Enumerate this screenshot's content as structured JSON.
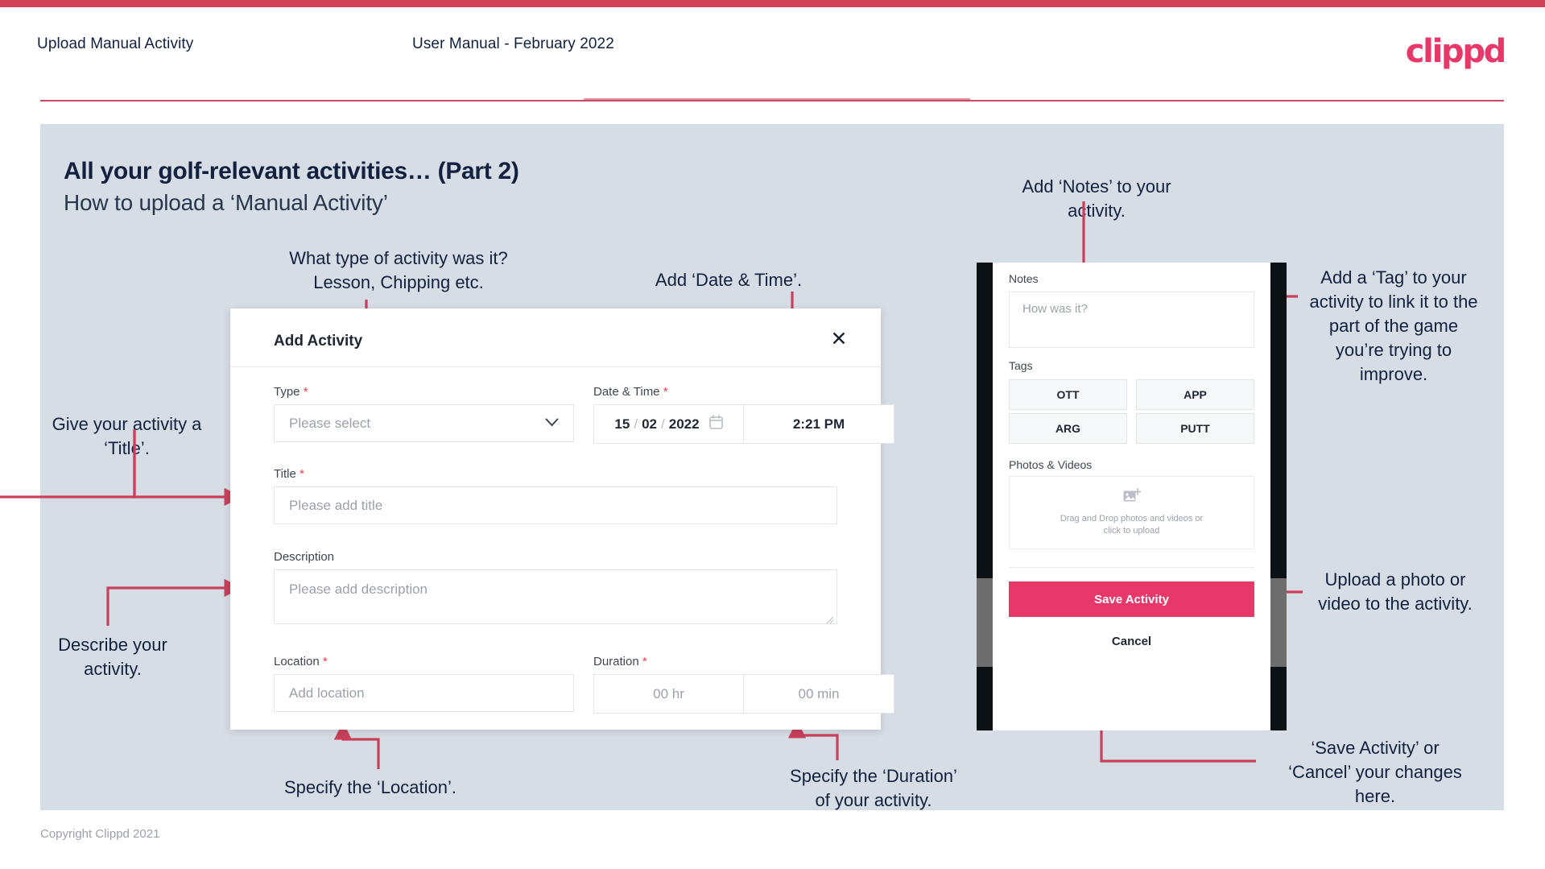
{
  "header": {
    "left_title": "Upload Manual Activity",
    "center_title": "User Manual - February 2022",
    "logo": "clippd"
  },
  "slide": {
    "heading": "All your golf-relevant activities… (Part 2)",
    "subheading": "How to upload a ‘Manual Activity’"
  },
  "annotations": {
    "type": "What type of activity was it?\nLesson, Chipping etc.",
    "type_l1": "What type of activity was it?",
    "type_l2": "Lesson, Chipping etc.",
    "datetime": "Add ‘Date & Time’.",
    "notes_l1": "Add ‘Notes’ to your",
    "notes_l2": "activity.",
    "tag": "Add a ‘Tag’ to your activity to link it to the part of the game you’re trying to improve.",
    "title_l1": "Give your activity a",
    "title_l2": "‘Title’.",
    "describe_l1": "Describe your",
    "describe_l2": "activity.",
    "location": "Specify the ‘Location’.",
    "duration_l1": "Specify the ‘Duration’",
    "duration_l2": "of your activity.",
    "upload_l1": "Upload a photo or",
    "upload_l2": "video to the activity.",
    "save_l1": "‘Save Activity’ or",
    "save_l2": "‘Cancel’ your changes",
    "save_l3": "here."
  },
  "dialog": {
    "title": "Add Activity",
    "close_icon": "close-icon",
    "fields": {
      "type": {
        "label": "Type",
        "required": "*",
        "placeholder": "Please select"
      },
      "datetime": {
        "label": "Date & Time",
        "required": "*",
        "day": "15",
        "month": "02",
        "year": "2022",
        "sep": "/",
        "time": "2:21 PM"
      },
      "title": {
        "label": "Title",
        "required": "*",
        "placeholder": "Please add title"
      },
      "description": {
        "label": "Description",
        "required": "",
        "placeholder": "Please add description"
      },
      "location": {
        "label": "Location",
        "required": "*",
        "placeholder": "Add location"
      },
      "duration": {
        "label": "Duration",
        "required": "*",
        "hours": "00 hr",
        "minutes": "00 min"
      }
    }
  },
  "phone": {
    "notes_label": "Notes",
    "notes_placeholder": "How was it?",
    "tags_label": "Tags",
    "tags": [
      "OTT",
      "APP",
      "ARG",
      "PUTT"
    ],
    "photos_label": "Photos & Videos",
    "dropzone_l1": "Drag and Drop photos and videos or",
    "dropzone_l2": "click to upload",
    "save_label": "Save Activity",
    "cancel_label": "Cancel"
  },
  "footer": {
    "copyright": "Copyright Clippd 2021"
  },
  "colors": {
    "accent_pink": "#e8386a",
    "arrow_red": "#c9405c",
    "slide_bg": "#d7dde5",
    "navy": "#12213f"
  }
}
